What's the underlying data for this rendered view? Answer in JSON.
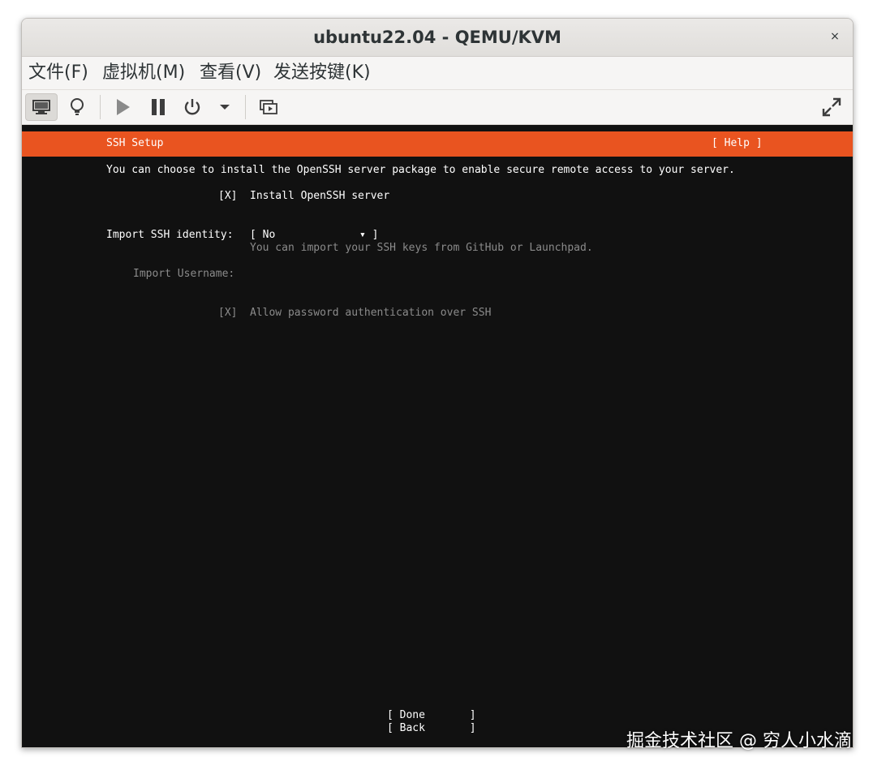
{
  "window": {
    "title": "ubuntu22.04 - QEMU/KVM",
    "close_glyph": "×"
  },
  "menubar": {
    "items": [
      "文件(F)",
      "虚拟机(M)",
      "查看(V)",
      "发送按键(K)"
    ]
  },
  "toolbar": {
    "buttons": [
      "console-view-icon",
      "details-lightbulb-icon",
      "run-play-icon",
      "pause-icon",
      "power-icon",
      "power-dropdown-icon",
      "snapshots-icon",
      "fullscreen-icon"
    ]
  },
  "installer": {
    "header_title": "SSH Setup",
    "help_label": "[ Help ]",
    "intro": "You can choose to install the OpenSSH server package to enable secure remote access to your server.",
    "install_openssh": {
      "checkbox": "[X]",
      "label": "Install OpenSSH server"
    },
    "import_identity": {
      "label": "Import SSH identity:",
      "select_open": "[ No",
      "select_arrow": "▾ ]",
      "help": "You can import your SSH keys from GitHub or Launchpad."
    },
    "import_username": {
      "label": "Import Username:"
    },
    "allow_password": {
      "checkbox": "[X]",
      "label": "Allow password authentication over SSH"
    },
    "done_button": "[ Done       ]",
    "back_button": "[ Back       ]"
  },
  "watermark": "掘金技术社区 @ 穷人小水滴",
  "colors": {
    "accent": "#e95420",
    "terminal_bg": "#111111"
  }
}
